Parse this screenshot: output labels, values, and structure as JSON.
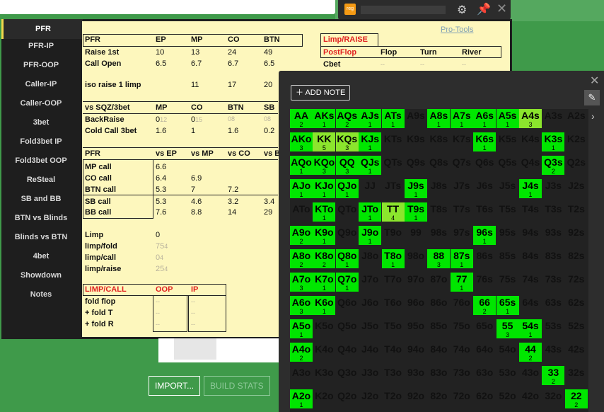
{
  "hud": {
    "logo": "reg"
  },
  "sidebar": [
    {
      "label": "PFR",
      "active": true
    },
    {
      "label": "PFR-IP"
    },
    {
      "label": "PFR-OOP"
    },
    {
      "label": "Caller-IP"
    },
    {
      "label": "Caller-OOP"
    },
    {
      "label": "3bet"
    },
    {
      "label": "Fold3bet IP"
    },
    {
      "label": "Fold3bet OOP"
    },
    {
      "label": "ReSteal"
    },
    {
      "label": "SB and BB"
    },
    {
      "label": "BTN vs Blinds"
    },
    {
      "label": "Blinds vs BTN"
    },
    {
      "label": "4bet"
    },
    {
      "label": "Showdown"
    },
    {
      "label": "Notes"
    }
  ],
  "protools": "Pro-Tools",
  "pfr": {
    "header": [
      "PFR",
      "EP",
      "MP",
      "CO",
      "BTN"
    ],
    "rows": [
      {
        "label": "Raise 1st",
        "v": [
          "10",
          "13",
          "24",
          "49"
        ]
      },
      {
        "label": "Call Open",
        "v": [
          "6.5",
          "6.7",
          "6.7",
          "6.5"
        ]
      },
      {
        "label": "iso raise 1 limp",
        "v": [
          "",
          "11",
          "17",
          "20"
        ]
      }
    ]
  },
  "sqz": {
    "header": [
      "vs SQZ/3bet",
      "MP",
      "CO",
      "BTN",
      "SB"
    ],
    "rows": [
      {
        "label": "BackRaise",
        "v": [
          "0",
          "0",
          "0",
          "0"
        ],
        "sub": [
          "12",
          "15",
          "8",
          "8"
        ]
      },
      {
        "label": "Cold Call 3bet",
        "v": [
          "1.6",
          "1",
          "1.6",
          "0.2"
        ]
      }
    ]
  },
  "vs": {
    "header": [
      "PFR",
      "vs EP",
      "vs MP",
      "vs CO",
      "vs B"
    ],
    "rows": [
      {
        "label": "MP call",
        "v": [
          "6.6",
          "",
          "",
          ""
        ]
      },
      {
        "label": "CO call",
        "v": [
          "6.4",
          "6.9",
          "",
          ""
        ]
      },
      {
        "label": "BTN call",
        "v": [
          "5.3",
          "7",
          "7.2",
          ""
        ]
      },
      {
        "label": "SB call",
        "v": [
          "5.3",
          "4.6",
          "3.2",
          "3.4"
        ]
      },
      {
        "label": "BB call",
        "v": [
          "7.6",
          "8.8",
          "14",
          "29"
        ]
      }
    ]
  },
  "limp": {
    "rows": [
      {
        "label": "Limp",
        "v": "0",
        "sub": ""
      },
      {
        "label": "limp/fold",
        "v": "75",
        "sub": "4"
      },
      {
        "label": "limp/call",
        "v": "0",
        "sub": "4"
      },
      {
        "label": "limp/raise",
        "v": "25",
        "sub": "4"
      }
    ]
  },
  "limpcall": {
    "header": [
      "LIMP/CALL",
      "OOP",
      "IP"
    ],
    "rows": [
      {
        "label": "fold flop",
        "oop": "--",
        "ip": "--"
      },
      {
        "label": "+ fold T",
        "oop": "--",
        "ip": "--"
      },
      {
        "label": "+ fold R",
        "oop": "--",
        "ip": "--"
      }
    ]
  },
  "postflop": {
    "tab": "Limp/RAISE",
    "header": [
      "PostFlop",
      "Flop",
      "Turn",
      "River"
    ],
    "rows": [
      {
        "label": "Cbet",
        "v": [
          "--",
          "--",
          "--"
        ]
      }
    ]
  },
  "buttons": {
    "import": "IMPORT...",
    "build": "BUILD STATS"
  },
  "notes": {
    "add_note": "ADD NOTE",
    "hands": [
      [
        "AA",
        "AKs",
        "AQs",
        "AJs",
        "ATs",
        "A9s",
        "A8s",
        "A7s",
        "A6s",
        "A5s",
        "A4s",
        "A3s",
        "A2s"
      ],
      [
        "AKo",
        "KK",
        "KQs",
        "KJs",
        "KTs",
        "K9s",
        "K8s",
        "K7s",
        "K6s",
        "K5s",
        "K4s",
        "K3s",
        "K2s"
      ],
      [
        "AQo",
        "KQo",
        "QQ",
        "QJs",
        "QTs",
        "Q9s",
        "Q8s",
        "Q7s",
        "Q6s",
        "Q5s",
        "Q4s",
        "Q3s",
        "Q2s"
      ],
      [
        "AJo",
        "KJo",
        "QJo",
        "JJ",
        "JTs",
        "J9s",
        "J8s",
        "J7s",
        "J6s",
        "J5s",
        "J4s",
        "J3s",
        "J2s"
      ],
      [
        "ATo",
        "KTo",
        "QTo",
        "JTo",
        "TT",
        "T9s",
        "T8s",
        "T7s",
        "T6s",
        "T5s",
        "T4s",
        "T3s",
        "T2s"
      ],
      [
        "A9o",
        "K9o",
        "Q9o",
        "J9o",
        "T9o",
        "99",
        "98s",
        "97s",
        "96s",
        "95s",
        "94s",
        "93s",
        "92s"
      ],
      [
        "A8o",
        "K8o",
        "Q8o",
        "J8o",
        "T8o",
        "98o",
        "88",
        "87s",
        "86s",
        "85s",
        "84s",
        "83s",
        "82s"
      ],
      [
        "A7o",
        "K7o",
        "Q7o",
        "J7o",
        "T7o",
        "97o",
        "87o",
        "77",
        "76s",
        "75s",
        "74s",
        "73s",
        "72s"
      ],
      [
        "A6o",
        "K6o",
        "Q6o",
        "J6o",
        "T6o",
        "96o",
        "86o",
        "76o",
        "66",
        "65s",
        "64s",
        "63s",
        "62s"
      ],
      [
        "A5o",
        "K5o",
        "Q5o",
        "J5o",
        "T5o",
        "95o",
        "85o",
        "75o",
        "65o",
        "55",
        "54s",
        "53s",
        "52s"
      ],
      [
        "A4o",
        "K4o",
        "Q4o",
        "J4o",
        "T4o",
        "94o",
        "84o",
        "74o",
        "64o",
        "54o",
        "44",
        "43s",
        "42s"
      ],
      [
        "A3o",
        "K3o",
        "Q3o",
        "J3o",
        "T3o",
        "93o",
        "83o",
        "73o",
        "63o",
        "53o",
        "43o",
        "33",
        "32s"
      ],
      [
        "A2o",
        "K2o",
        "Q2o",
        "J2o",
        "T2o",
        "92o",
        "82o",
        "72o",
        "62o",
        "52o",
        "42o",
        "32o",
        "22"
      ]
    ],
    "counts": [
      [
        "2",
        "1",
        "2",
        "1",
        "1",
        "",
        "1",
        "1",
        "1",
        "1",
        "3",
        "",
        ""
      ],
      [
        "3",
        "5",
        "3",
        "1",
        "",
        "",
        "",
        "",
        "1",
        "",
        "",
        "1",
        ""
      ],
      [
        "1",
        "3",
        "3",
        "1",
        "",
        "",
        "",
        "",
        "",
        "",
        "",
        "2",
        ""
      ],
      [
        "1",
        "1",
        "1",
        "",
        "",
        "1",
        "",
        "",
        "",
        "",
        "1",
        "",
        ""
      ],
      [
        "",
        "1",
        "",
        "1",
        "4",
        "1",
        "",
        "",
        "",
        "",
        "",
        "",
        ""
      ],
      [
        "2",
        "1",
        "",
        "1",
        "",
        "",
        "",
        "",
        "1",
        "",
        "",
        "",
        ""
      ],
      [
        "2",
        "2",
        "1",
        "",
        "1",
        "",
        "3",
        "1",
        "",
        "",
        "",
        "",
        ""
      ],
      [
        "3",
        "1",
        "1",
        "",
        "",
        "",
        "",
        "1",
        "",
        "",
        "",
        "",
        ""
      ],
      [
        "3",
        "1",
        "",
        "",
        "",
        "",
        "",
        "",
        "2",
        "1",
        "",
        "",
        ""
      ],
      [
        "1",
        "",
        "",
        "",
        "",
        "",
        "",
        "",
        "",
        "3",
        "1",
        "",
        ""
      ],
      [
        "2",
        "",
        "",
        "",
        "",
        "",
        "",
        "",
        "",
        "",
        "2",
        "",
        ""
      ],
      [
        "",
        "",
        "",
        "",
        "",
        "",
        "",
        "",
        "",
        "",
        "",
        "2",
        ""
      ],
      [
        "1",
        "",
        "",
        "",
        "",
        "",
        "",
        "",
        "",
        "",
        "",
        "",
        "2"
      ]
    ],
    "colors": {
      "bright": "#00e600",
      "light": "#8be52d",
      "empty": "#222222"
    }
  }
}
